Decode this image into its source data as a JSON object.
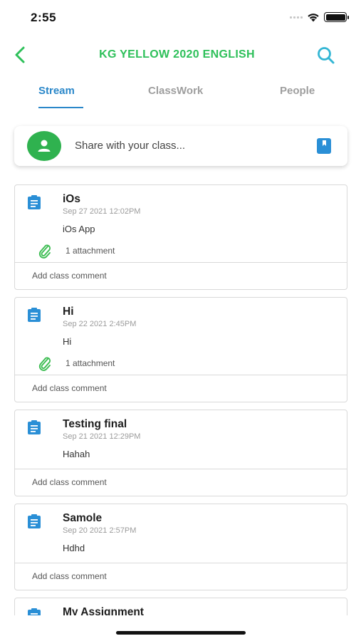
{
  "status": {
    "time": "2:55"
  },
  "header": {
    "title": "KG YELLOW 2020 ENGLISH",
    "back_icon": "chevron-left-icon",
    "search_icon": "search-icon"
  },
  "tabs": [
    {
      "label": "Stream",
      "active": true
    },
    {
      "label": "ClassWork",
      "active": false
    },
    {
      "label": "People",
      "active": false
    }
  ],
  "share": {
    "placeholder": "Share with your class..."
  },
  "colors": {
    "accent_green": "#2ec05a",
    "accent_blue": "#2a87c9",
    "avatar_green": "#2fb24f",
    "icon_blue": "#2a8fd6"
  },
  "posts": [
    {
      "title": "iOs",
      "date": "Sep 27 2021 12:02PM",
      "text": "iOs App",
      "attachment": "1 attachment",
      "comment": "Add class comment"
    },
    {
      "title": "Hi",
      "date": "Sep 22 2021  2:45PM",
      "text": "Hi",
      "attachment": "1 attachment",
      "comment": "Add class comment"
    },
    {
      "title": "Testing final",
      "date": "Sep 21 2021 12:29PM",
      "text": "Hahah",
      "comment": "Add class comment"
    },
    {
      "title": "Samole",
      "date": "Sep 20 2021  2:57PM",
      "text": "Hdhd",
      "comment": "Add class comment"
    },
    {
      "title": "My Assignment"
    }
  ]
}
